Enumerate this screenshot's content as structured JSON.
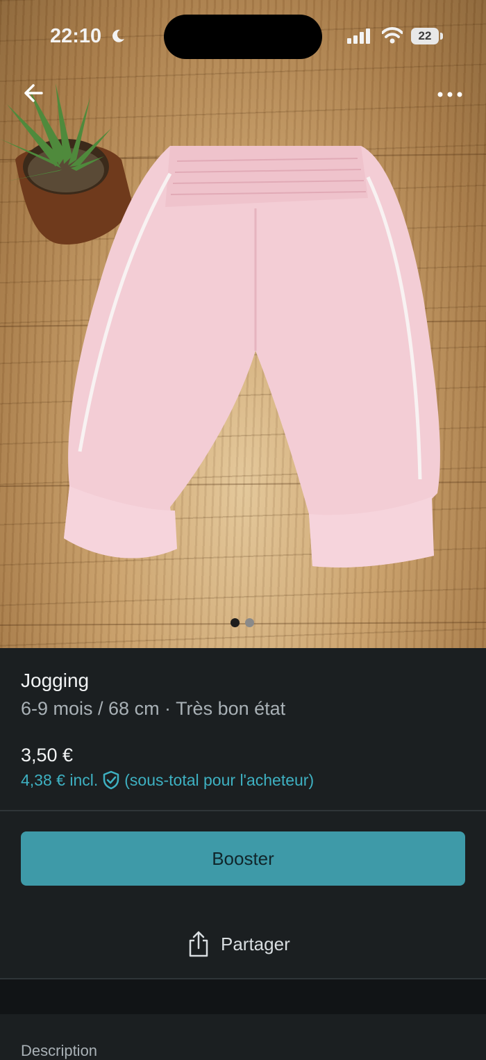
{
  "status_bar": {
    "time": "22:10",
    "battery": "22"
  },
  "photo": {
    "page_count": 2,
    "current_page": 1
  },
  "item": {
    "title": "Jogging",
    "subtitle": "6-9 mois / 68 cm · Très bon état",
    "price": "3,50 €",
    "price_incl": "4,38 € incl.",
    "price_note": "(sous-total pour l'acheteur)"
  },
  "actions": {
    "booster_label": "Booster",
    "share_label": "Partager"
  },
  "section": {
    "description_label": "Description"
  },
  "colors": {
    "accent": "#3e9aa8",
    "link": "#3eb1c2",
    "background": "#1b1f21"
  },
  "icons": [
    "moon-icon",
    "signal-icon",
    "wifi-icon",
    "battery-icon",
    "back-arrow-icon",
    "more-icon",
    "shield-check-icon",
    "share-icon"
  ]
}
